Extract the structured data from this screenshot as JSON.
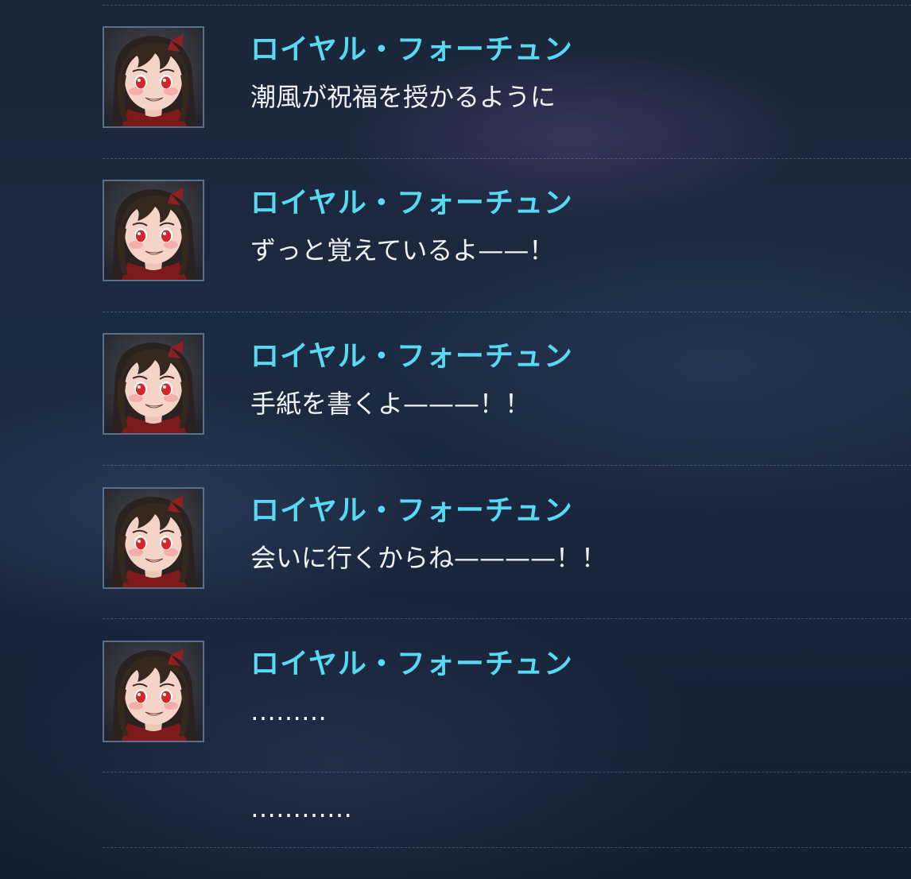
{
  "log": {
    "entries": [
      {
        "speaker": "ロイヤル・フォーチュン",
        "text": "潮風が祝福を授かるように",
        "avatar": "royal-fortune-portrait"
      },
      {
        "speaker": "ロイヤル・フォーチュン",
        "text": "ずっと覚えているよ——！",
        "avatar": "royal-fortune-portrait"
      },
      {
        "speaker": "ロイヤル・フォーチュン",
        "text": "手紙を書くよ———！！",
        "avatar": "royal-fortune-portrait"
      },
      {
        "speaker": "ロイヤル・フォーチュン",
        "text": "会いに行くからね————！！",
        "avatar": "royal-fortune-portrait"
      },
      {
        "speaker": "ロイヤル・フォーチュン",
        "text": "………",
        "avatar": "royal-fortune-portrait"
      }
    ],
    "narration": "…………"
  },
  "colors": {
    "speaker": "#57d8f3",
    "text": "#f1f3f7",
    "avatar_border": "#5a6f8c"
  }
}
